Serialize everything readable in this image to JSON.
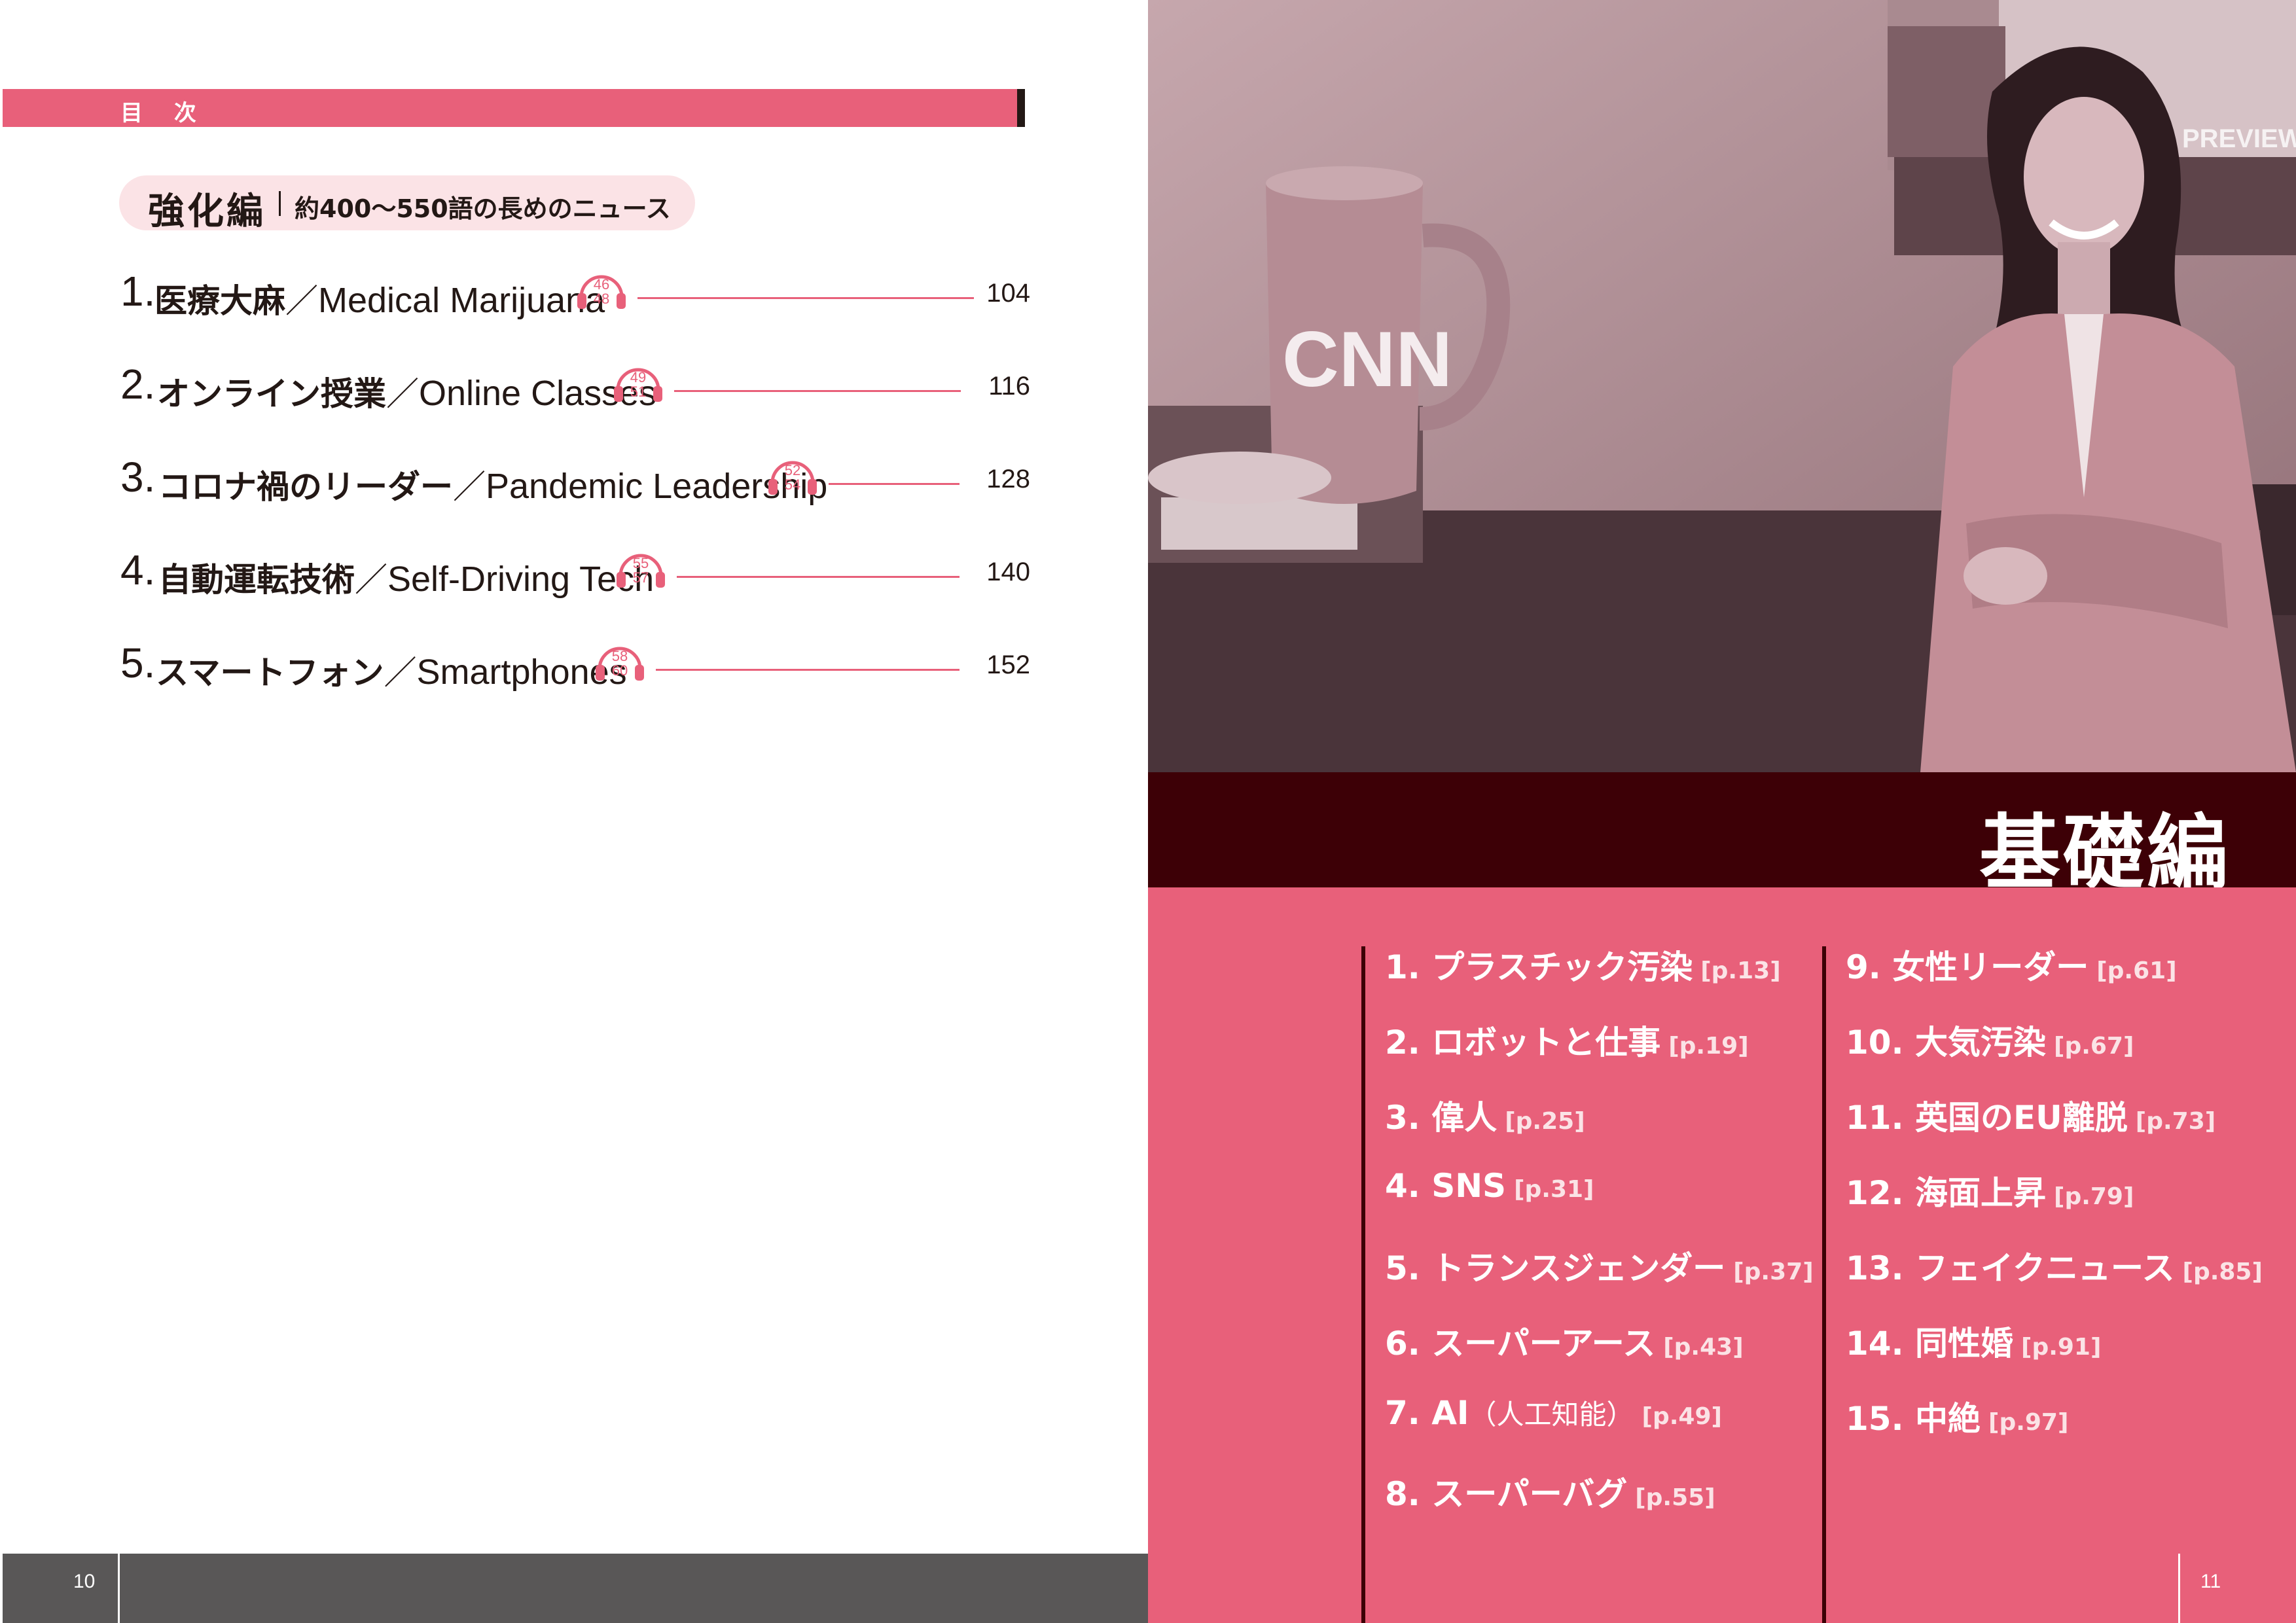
{
  "left_page": {
    "header_label": "目 次",
    "section": {
      "title": "強化編",
      "description": "約400〜550語の長めのニュース"
    },
    "entries": [
      {
        "number": "1.",
        "title_ja": "医療大麻",
        "title_en": "Medical Marijuana",
        "tracks": [
          "46",
          "48"
        ],
        "page": "104"
      },
      {
        "number": "2.",
        "title_ja": "オンライン授業",
        "title_en": "Online Classes",
        "tracks": [
          "49",
          "51"
        ],
        "page": "116"
      },
      {
        "number": "3.",
        "title_ja": "コロナ禍のリーダー",
        "title_en": "Pandemic Leadership",
        "tracks": [
          "52",
          "54"
        ],
        "page": "128"
      },
      {
        "number": "4.",
        "title_ja": "自動運転技術",
        "title_en": "Self-Driving Tech",
        "tracks": [
          "55",
          "57"
        ],
        "page": "140"
      },
      {
        "number": "5.",
        "title_ja": "スマートフォン",
        "title_en": "Smartphones",
        "tracks": [
          "58",
          "60"
        ],
        "page": "152"
      }
    ],
    "separator": "／",
    "page_number": "10"
  },
  "right_page": {
    "photo": {
      "mug_logo": "CNN",
      "monitor_text": "PREVIEW"
    },
    "title": "基礎編",
    "left_column": [
      {
        "label": "1. プラスチック汚染",
        "page_ref": "[p.13]"
      },
      {
        "label": "2. ロボットと仕事",
        "page_ref": "[p.19]"
      },
      {
        "label": "3. 偉人",
        "page_ref": "[p.25]"
      },
      {
        "label": "4. SNS",
        "page_ref": "[p.31]"
      },
      {
        "label": "5. トランスジェンダー",
        "page_ref": "[p.37]"
      },
      {
        "label": "6. スーパーアース",
        "page_ref": "[p.43]"
      },
      {
        "label": "7. AI",
        "paren": "（人工知能）",
        "page_ref": "[p.49]"
      },
      {
        "label": "8. スーパーバグ",
        "page_ref": "[p.55]"
      }
    ],
    "right_column": [
      {
        "label": "9. 女性リーダー",
        "page_ref": "[p.61]"
      },
      {
        "label": "10. 大気汚染",
        "page_ref": "[p.67]"
      },
      {
        "label": "11. 英国のEU離脱",
        "page_ref": "[p.73]"
      },
      {
        "label": "12. 海面上昇",
        "page_ref": "[p.79]"
      },
      {
        "label": "13. フェイクニュース",
        "page_ref": "[p.85]"
      },
      {
        "label": "14. 同性婚",
        "page_ref": "[p.91]"
      },
      {
        "label": "15. 中絶",
        "page_ref": "[p.97]"
      }
    ],
    "page_number": "11"
  }
}
